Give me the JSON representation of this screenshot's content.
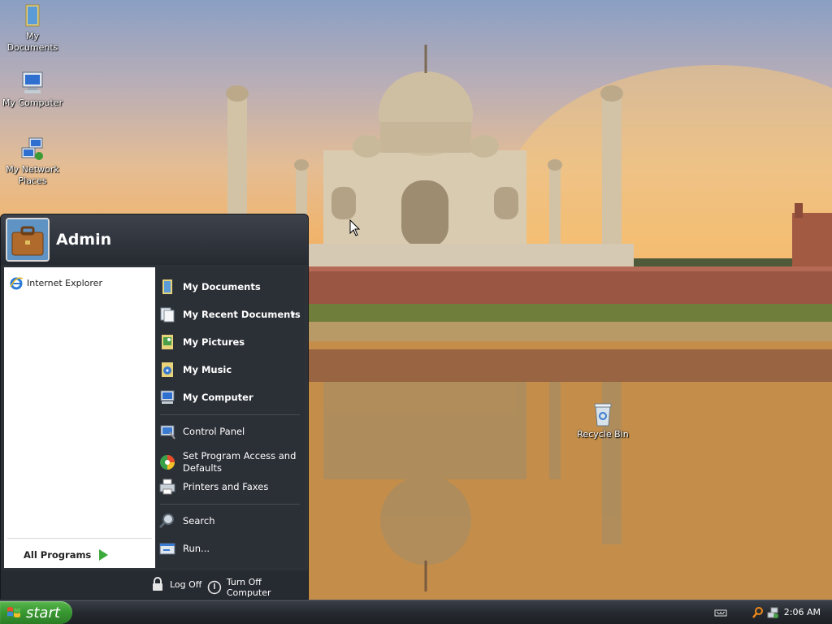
{
  "desktop": {
    "icons": [
      {
        "label": "My Documents",
        "icon": "folder-documents-icon"
      },
      {
        "label": "My Computer",
        "icon": "computer-icon"
      },
      {
        "label": "My Network Places",
        "icon": "network-places-icon"
      },
      {
        "label": "Recycle Bin",
        "icon": "recycle-bin-icon"
      }
    ]
  },
  "start_menu": {
    "user_name": "Admin",
    "pinned": [
      {
        "label": "Internet Explorer",
        "icon": "internet-explorer-icon"
      }
    ],
    "all_programs_label": "All Programs",
    "places": [
      {
        "label": "My Documents",
        "icon": "my-documents-icon"
      },
      {
        "label": "My Recent Documents",
        "icon": "recent-documents-icon",
        "has_submenu": true
      },
      {
        "label": "My Pictures",
        "icon": "my-pictures-icon"
      },
      {
        "label": "My Music",
        "icon": "my-music-icon"
      },
      {
        "label": "My Computer",
        "icon": "my-computer-icon"
      }
    ],
    "system": [
      {
        "label": "Control Panel",
        "icon": "control-panel-icon"
      },
      {
        "label": "Set Program Access and Defaults",
        "icon": "program-access-icon"
      },
      {
        "label": "Printers and Faxes",
        "icon": "printer-icon"
      }
    ],
    "tools": [
      {
        "label": "Search",
        "icon": "search-icon"
      },
      {
        "label": "Run...",
        "icon": "run-icon"
      }
    ],
    "footer": {
      "log_off": "Log Off",
      "turn_off": "Turn Off Computer"
    }
  },
  "taskbar": {
    "start_label": "start",
    "clock": "2:06 AM"
  },
  "colors": {
    "menu_bg": "#2d3138",
    "start_button": "#3a9a33",
    "taskbar": "#262a30"
  }
}
